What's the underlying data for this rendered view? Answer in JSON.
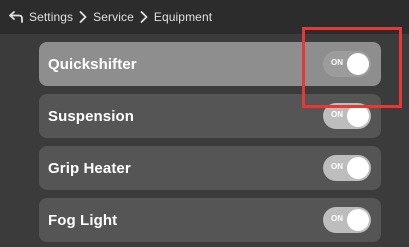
{
  "breadcrumb": {
    "items": [
      "Settings",
      "Service",
      "Equipment"
    ]
  },
  "settings_list": [
    {
      "label": "Quickshifter",
      "toggle_state": "ON",
      "selected": true
    },
    {
      "label": "Suspension",
      "toggle_state": "ON",
      "selected": false
    },
    {
      "label": "Grip Heater",
      "toggle_state": "ON",
      "selected": false
    },
    {
      "label": "Fog Light",
      "toggle_state": "ON",
      "selected": false
    }
  ],
  "icons": {
    "back": "back-arrow-icon",
    "separator": "chevron-right-icon"
  },
  "colors": {
    "highlight": "#e53935",
    "selected_row": "#8e8e8e",
    "row": "#555555",
    "toggle_on": "#bdbdbd"
  }
}
